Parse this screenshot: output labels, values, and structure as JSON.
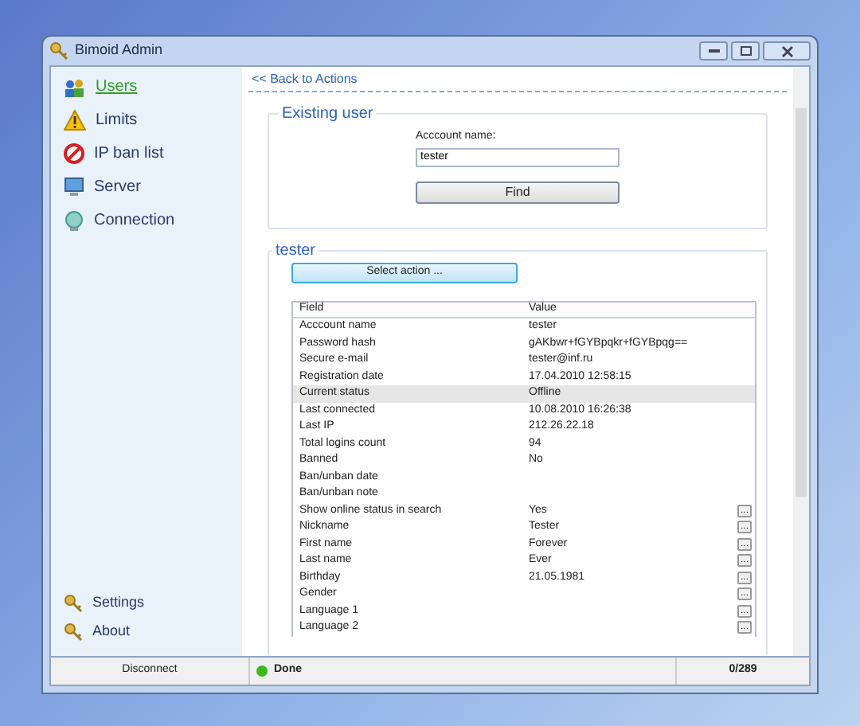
{
  "window": {
    "title": "Bimoid Admin"
  },
  "sidebar": {
    "items": [
      {
        "label": "Users",
        "selected": true,
        "kind": "users"
      },
      {
        "label": "Limits",
        "selected": false,
        "kind": "warning"
      },
      {
        "label": "IP ban list",
        "selected": false,
        "kind": "ban"
      },
      {
        "label": "Server",
        "selected": false,
        "kind": "server"
      },
      {
        "label": "Connection",
        "selected": false,
        "kind": "connection"
      }
    ],
    "bottom_items": [
      {
        "label": "Settings"
      },
      {
        "label": "About"
      }
    ]
  },
  "back_link": "<< Back to Actions",
  "existing_user": {
    "title": "Existing user",
    "field_label": "Acccount name:",
    "value": "tester",
    "button": "Find"
  },
  "user_group": {
    "title": "tester",
    "action_button": "Select action ...",
    "table": {
      "columns": [
        "Field",
        "Value"
      ],
      "rows": [
        {
          "field": "Acccount name",
          "value": "tester",
          "selected": false,
          "editable": false
        },
        {
          "field": "Password hash",
          "value": "gAKbwr+fGYBpqkr+fGYBpqg==",
          "selected": false,
          "editable": false
        },
        {
          "field": "Secure e-mail",
          "value": "tester@inf.ru",
          "selected": false,
          "editable": false
        },
        {
          "field": "Registration date",
          "value": "17.04.2010 12:58:15",
          "selected": false,
          "editable": false
        },
        {
          "field": "Current status",
          "value": "Offline",
          "selected": true,
          "editable": false
        },
        {
          "field": "Last connected",
          "value": "10.08.2010 16:26:38",
          "selected": false,
          "editable": false
        },
        {
          "field": "Last IP",
          "value": "212.26.22.18",
          "selected": false,
          "editable": false
        },
        {
          "field": "Total logins count",
          "value": "94",
          "selected": false,
          "editable": false
        },
        {
          "field": "Banned",
          "value": "No",
          "selected": false,
          "editable": false
        },
        {
          "field": "Ban/unban date",
          "value": "",
          "selected": false,
          "editable": false
        },
        {
          "field": "Ban/unban note",
          "value": "",
          "selected": false,
          "editable": false
        },
        {
          "field": "Show online status in search",
          "value": "Yes",
          "selected": false,
          "editable": true
        },
        {
          "field": "Nickname",
          "value": "Tester",
          "selected": false,
          "editable": true
        },
        {
          "field": "First name",
          "value": "Forever",
          "selected": false,
          "editable": true
        },
        {
          "field": "Last name",
          "value": "Ever",
          "selected": false,
          "editable": true
        },
        {
          "field": "Birthday",
          "value": "21.05.1981",
          "selected": false,
          "editable": true
        },
        {
          "field": "Gender",
          "value": "",
          "selected": false,
          "editable": true
        },
        {
          "field": "Language 1",
          "value": "",
          "selected": false,
          "editable": true
        },
        {
          "field": "Language 2",
          "value": "",
          "selected": false,
          "editable": true
        }
      ]
    },
    "edit_button": "..."
  },
  "status_bar": {
    "disconnect": "Disconnect",
    "status": "Done",
    "online": true,
    "counter": "0/289"
  }
}
